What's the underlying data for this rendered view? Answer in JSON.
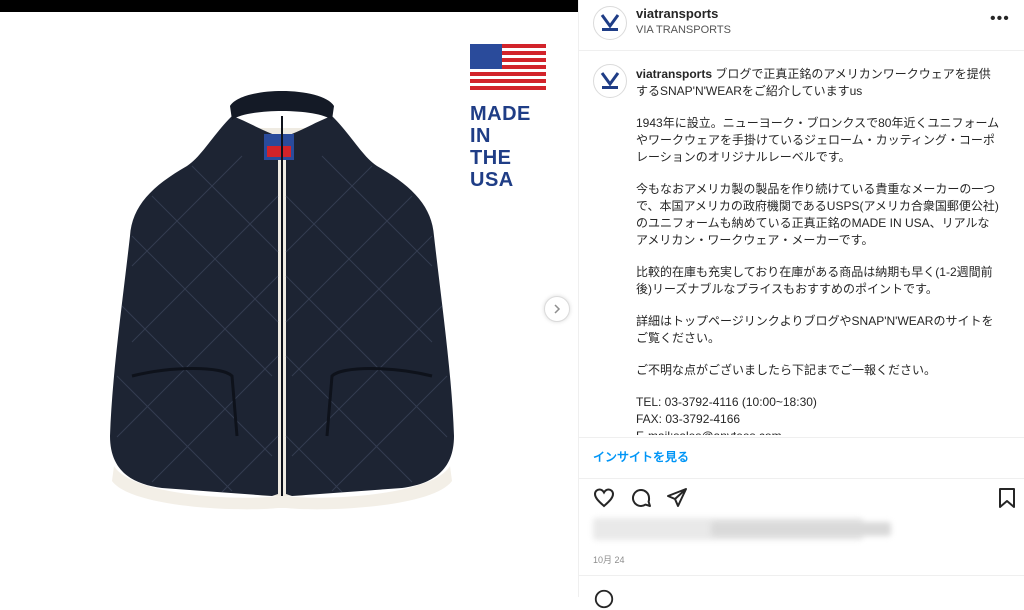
{
  "post": {
    "username": "viatransports",
    "location": "VIA TRANSPORTS",
    "more_label": "•••",
    "caption": {
      "username": "viatransports",
      "intro": "ブログで正真正銘のアメリカンワークウェアを提供するSNAP'N'WEARをご紹介していますus",
      "paragraphs": [
        "1943年に設立。ニューヨーク・ブロンクスで80年近くユニフォームやワークウェアを手掛けているジェローム・カッティング・コーポレーションのオリジナルレーベルです。",
        "今もなおアメリカ製の製品を作り続けている貴重なメーカーの一つで、本国アメリカの政府機関であるUSPS(アメリカ合衆国郵便公社)のユニフォームも納めている正真正銘のMADE IN USA、リアルなアメリカン・ワークウェア・メーカーです。",
        "比較的在庫も充実しており在庫がある商品は納期も早く(1-2週間前後)リーズナブルなプライスもおすすめのポイントです。",
        "詳細はトップページリンクよりブログやSNAP'N'WEARのサイトをご覧ください。",
        "ご不明な点がございましたら下記までご一報ください。",
        "TEL: 03-3792-4116 (10:00~18:30)\nFAX: 03-3792-4166\nE-mail:sales@anytees.com"
      ]
    },
    "insights_label": "インサイトを見る",
    "date": "10月 24"
  },
  "media": {
    "badge_text": "MADE IN\nTHE USA",
    "icons": [
      "us-flag-icon",
      "chevron-right-icon"
    ]
  },
  "actions": {
    "icons": [
      "heart-icon",
      "comment-icon",
      "share-icon",
      "bookmark-icon"
    ]
  },
  "colors": {
    "insight_blue": "#0095f6",
    "badge_blue": "#1f3d86",
    "vest_navy": "#1d2433"
  }
}
